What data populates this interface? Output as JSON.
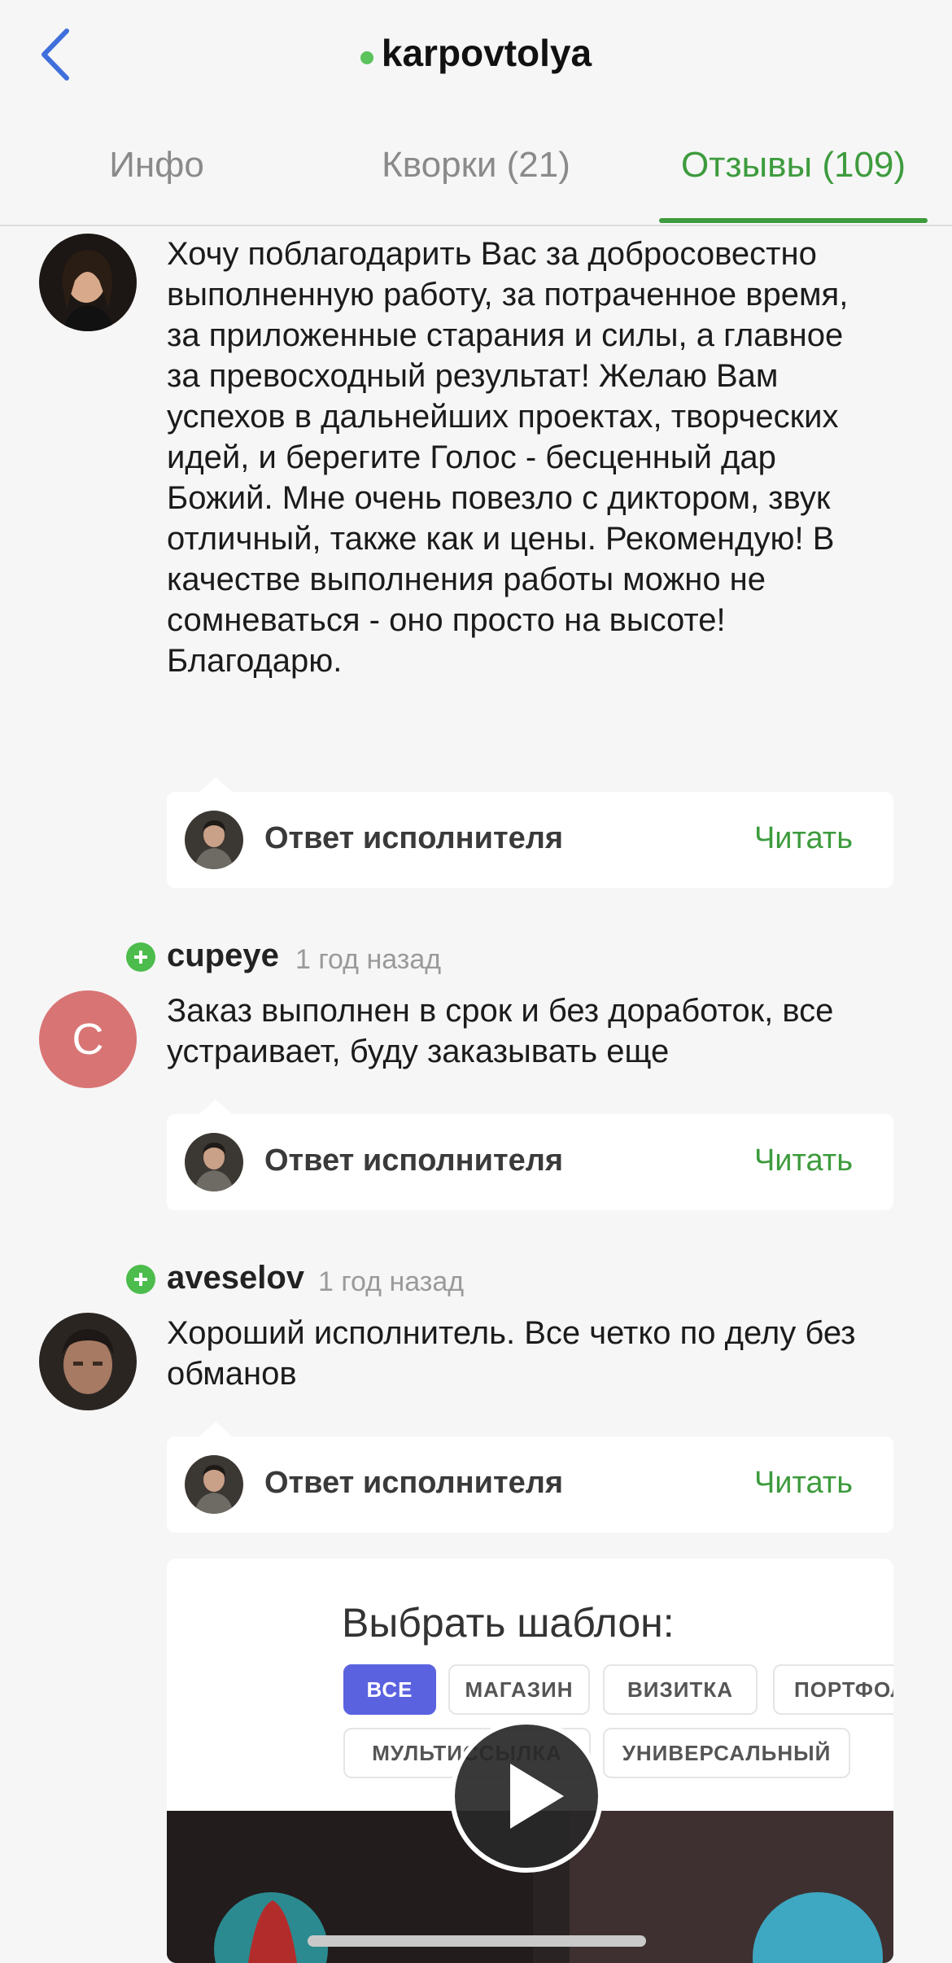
{
  "header": {
    "title": "karpovtolya",
    "online_color": "#5bc35b",
    "back_icon": "chevron-left-icon",
    "tabs": [
      {
        "label": "Инфо",
        "active": false
      },
      {
        "label": "Кворки (21)",
        "active": false
      },
      {
        "label": "Отзывы (109)",
        "active": true
      }
    ],
    "accent_color": "#3d9b3d"
  },
  "reviews": [
    {
      "username": "",
      "time": "",
      "avatar": "photo",
      "text": "Хочу поблагодарить Вас за добросовестно выполненную работу, за потраченное время, за приложенные старания и силы, а главное за превосходный результат! Желаю Вам успехов в дальнейших проектах, творческих идей, и берегите Голос - бесценный дар Божий. Мне очень повезло с диктором, звук отличный, также как и цены. Рекомендую! В качестве выполнения работы можно не сомневаться - оно просто на высоте! Благодарю.",
      "reply_label": "Ответ исполнителя",
      "reply_read": "Читать"
    },
    {
      "username": "cupeye",
      "time": "1 год назад",
      "avatar_letter": "C",
      "avatar_color": "#d97474",
      "text": "Заказ выполнен в срок и без доработок, все устраивает, буду заказывать еще",
      "reply_label": "Ответ исполнителя",
      "reply_read": "Читать"
    },
    {
      "username": "aveselov",
      "time": "1 год назад",
      "avatar": "photo",
      "text": "Хороший исполнитель. Все четко по делу без обманов",
      "reply_label": "Ответ исполнителя",
      "reply_read": "Читать"
    }
  ],
  "media": {
    "title": "Выбрать шаблон:",
    "chips": [
      "ВСЕ",
      "МАГАЗИН",
      "ВИЗИТКА",
      "ПОРТФОЛИО",
      "МУЛЬТИССЫЛКА",
      "УНИВЕРСАЛЬНЫЙ"
    ],
    "play_icon": "play-icon"
  }
}
